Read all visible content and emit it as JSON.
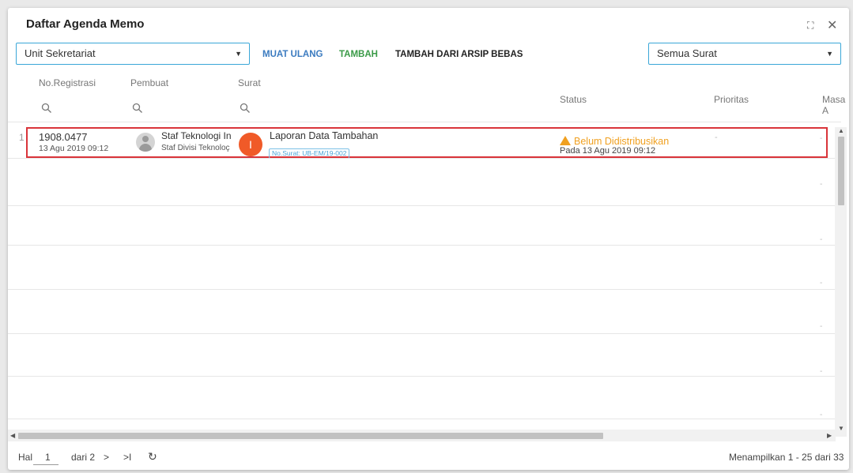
{
  "window": {
    "title": "Daftar Agenda Memo"
  },
  "toolbar": {
    "unit_select": "Unit Sekretariat",
    "reload_label": "MUAT ULANG",
    "add_label": "TAMBAH",
    "add_archive_label": "TAMBAH DARI ARSIP BEBAS",
    "filter_select": "Semua Surat",
    "colors": {
      "reload": "#3b7bc0",
      "add": "#3a9a47",
      "add_archive": "#222222"
    }
  },
  "columns": {
    "reg": "No.Registrasi",
    "creator": "Pembuat",
    "letter": "Surat",
    "status": "Status",
    "priority": "Prioritas",
    "deadline": "Masa A"
  },
  "rows": [
    {
      "index": "1",
      "reg_no": "1908.0477",
      "reg_date": "13 Agu 2019 09:12",
      "creator_name": "Staf Teknologi In",
      "creator_unit": "Staf Divisi Teknoloç",
      "letter_initial": "I",
      "letter_title": "Laporan Data Tambahan",
      "letter_no": "No.Surat: UB-EM/19-002",
      "status": "Belum Didistribusikan",
      "status_date": "Pada 13 Agu 2019 09:12",
      "priority": "-",
      "deadline": "-"
    }
  ],
  "empty_dashes": [
    "-",
    "-",
    "-",
    "-",
    "-",
    "-"
  ],
  "footer": {
    "page_label": "Hal",
    "page": "1",
    "of_label": "dari 2",
    "next": ">",
    "last": ">I",
    "refresh": "C",
    "summary": "Menampilkan 1 - 25 dari 33"
  }
}
